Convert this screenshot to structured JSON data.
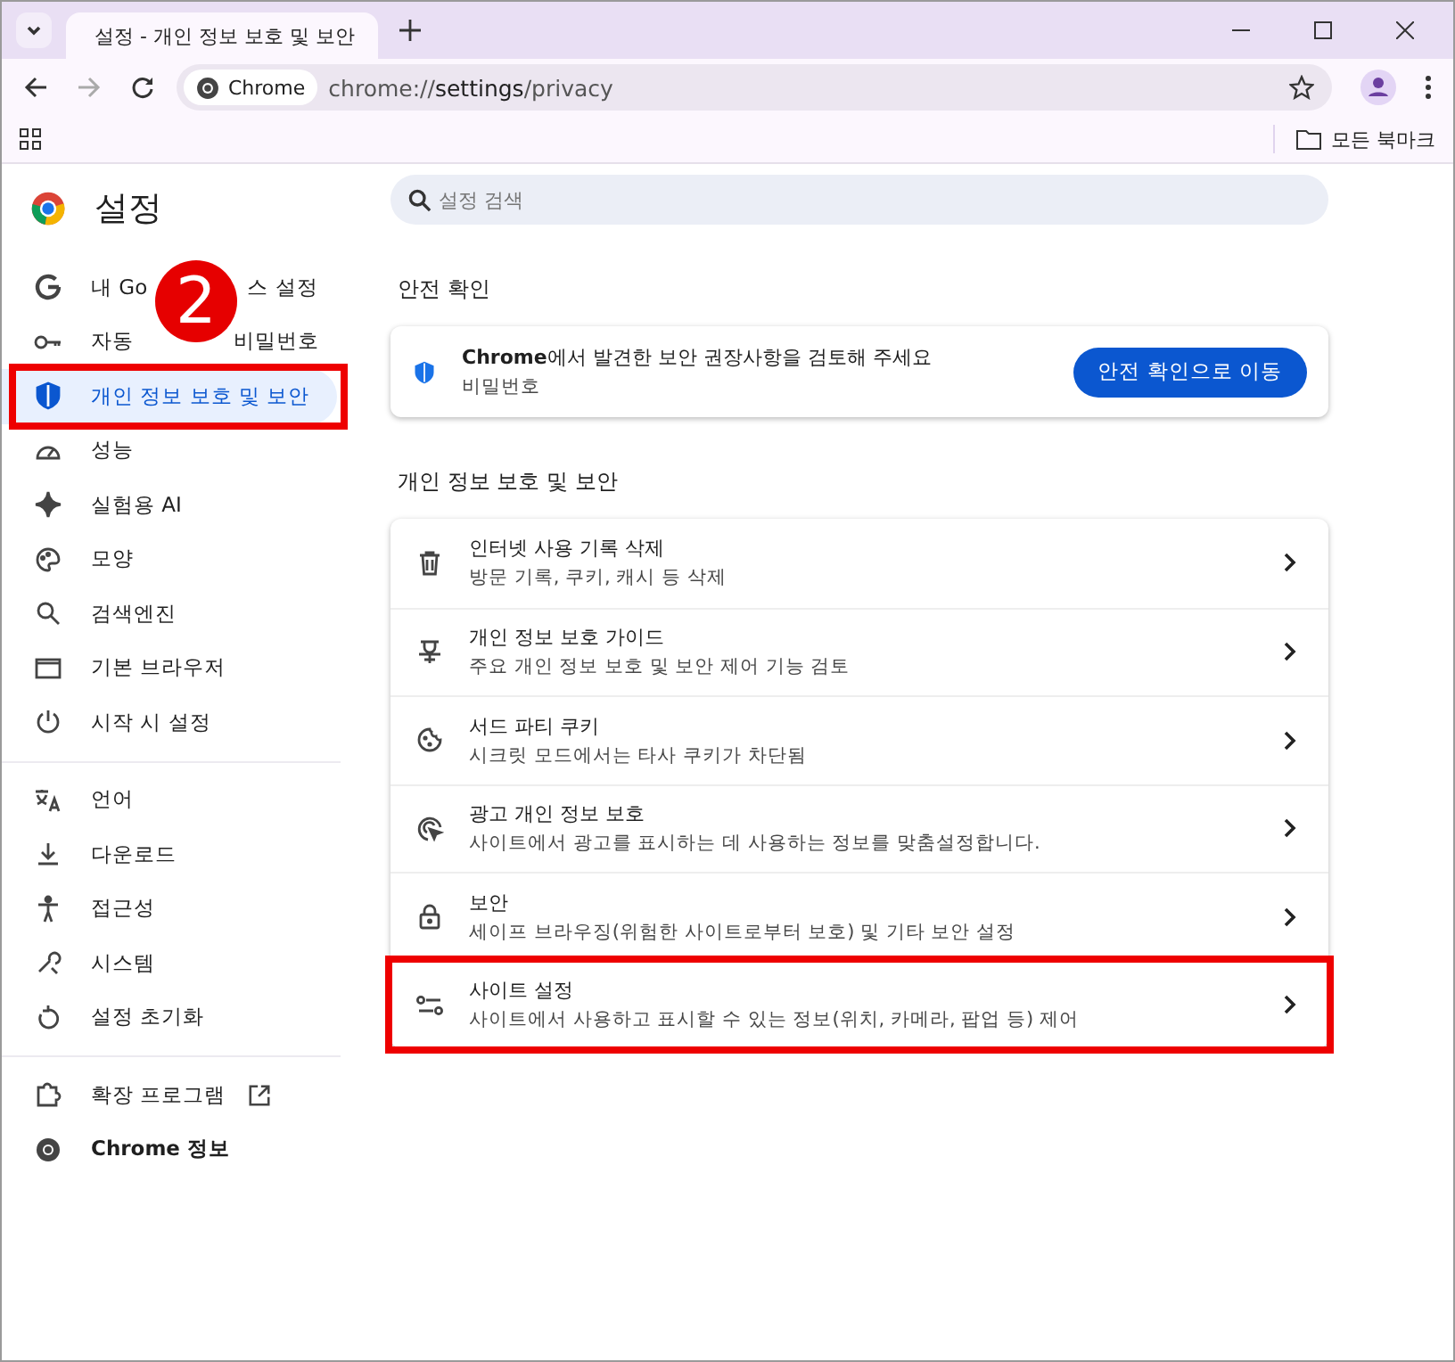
{
  "browser": {
    "tab_title": "설정 - 개인 정보 보호 및 보안",
    "chip": "Chrome",
    "url_host": "chrome://",
    "url_bold": "settings",
    "url_path": "/privacy",
    "bookmarks_label": "모든 북마크"
  },
  "sidebar": {
    "title": "설정",
    "callout": "2",
    "groups": [
      [
        {
          "label": "내 Go",
          "label_end": "스 설정",
          "selected": false,
          "highlighted": false
        },
        {
          "label": "자동",
          "label_end": "비밀번호",
          "selected": false,
          "highlighted": false
        },
        {
          "label": "개인 정보 보호 및 보안",
          "selected": true,
          "highlighted": true
        },
        {
          "label": "성능",
          "selected": false,
          "highlighted": false
        },
        {
          "label": "실험용 AI",
          "selected": false,
          "highlighted": false
        },
        {
          "label": "모양",
          "selected": false,
          "highlighted": false
        },
        {
          "label": "검색엔진",
          "selected": false,
          "highlighted": false
        },
        {
          "label": "기본 브라우저",
          "selected": false,
          "highlighted": false
        },
        {
          "label": "시작 시 설정",
          "selected": false,
          "highlighted": false
        }
      ],
      [
        {
          "label": "언어",
          "selected": false,
          "highlighted": false
        },
        {
          "label": "다운로드",
          "selected": false,
          "highlighted": false
        },
        {
          "label": "접근성",
          "selected": false,
          "highlighted": false
        },
        {
          "label": "시스템",
          "selected": false,
          "highlighted": false
        },
        {
          "label": "설정 초기화",
          "selected": false,
          "highlighted": false
        }
      ],
      [
        {
          "label": "확장 프로그램",
          "selected": false,
          "highlighted": false
        },
        {
          "label": "Chrome 정보",
          "selected": false,
          "highlighted": false
        }
      ]
    ]
  },
  "search": {
    "placeholder": "설정 검색"
  },
  "safety_check": {
    "heading": "안전 확인",
    "title_bold": "Chrome",
    "title_rest": "에서 발견한 보안 권장사항을 검토해 주세요",
    "subtitle": "비밀번호",
    "button": "안전 확인으로 이동"
  },
  "privacy": {
    "heading": "개인 정보 보호 및 보안",
    "rows": [
      {
        "title": "인터넷 사용 기록 삭제",
        "subtitle": "방문 기록, 쿠키, 캐시 등 삭제",
        "highlighted": false
      },
      {
        "title": "개인 정보 보호 가이드",
        "subtitle": "주요 개인 정보 보호 및 보안 제어 기능 검토",
        "highlighted": false
      },
      {
        "title": "서드 파티 쿠키",
        "subtitle": "시크릿 모드에서는 타사 쿠키가 차단됨",
        "highlighted": false
      },
      {
        "title": "광고 개인 정보 보호",
        "subtitle": "사이트에서 광고를 표시하는 데 사용하는 정보를 맞춤설정합니다.",
        "highlighted": false
      },
      {
        "title": "보안",
        "subtitle": "세이프 브라우징(위험한 사이트로부터 보호) 및 기타 보안 설정",
        "highlighted": false
      },
      {
        "title": "사이트 설정",
        "subtitle": "사이트에서 사용하고 표시할 수 있는 정보(위치, 카메라, 팝업 등) 제어",
        "highlighted": true
      }
    ]
  }
}
